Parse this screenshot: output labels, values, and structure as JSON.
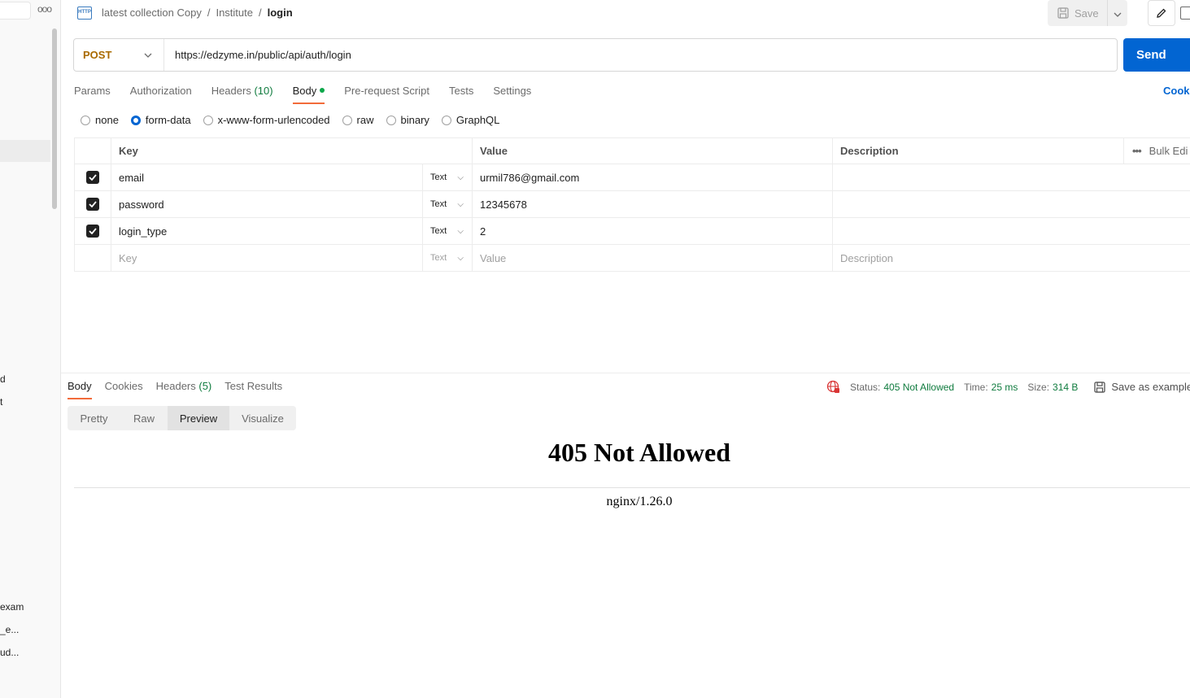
{
  "sidebar": {
    "more_label": "ooo",
    "items": [
      {
        "label": "d"
      },
      {
        "label": "t"
      },
      {
        "label": "exam"
      },
      {
        "label": "_e..."
      },
      {
        "label": "ud..."
      }
    ]
  },
  "header": {
    "http_icon_label": "HTTP",
    "breadcrumb": [
      "latest collection Copy",
      "Institute",
      "login"
    ],
    "save_label": "Save"
  },
  "request": {
    "method": "POST",
    "url": "https://edzyme.in/public/api/auth/login",
    "send_label": "Send"
  },
  "request_tabs": [
    {
      "label": "Params"
    },
    {
      "label": "Authorization"
    },
    {
      "label": "Headers",
      "count": "(10)"
    },
    {
      "label": "Body"
    },
    {
      "label": "Pre-request Script"
    },
    {
      "label": "Tests"
    },
    {
      "label": "Settings"
    }
  ],
  "cookies_label": "Cooki",
  "body_types": [
    {
      "label": "none",
      "checked": false
    },
    {
      "label": "form-data",
      "checked": true
    },
    {
      "label": "x-www-form-urlencoded",
      "checked": false
    },
    {
      "label": "raw",
      "checked": false
    },
    {
      "label": "binary",
      "checked": false
    },
    {
      "label": "GraphQL",
      "checked": false
    }
  ],
  "params_table": {
    "headers": {
      "key": "Key",
      "value": "Value",
      "description": "Description",
      "bulk_edit": "Bulk Edi"
    },
    "rows": [
      {
        "checked": true,
        "key": "email",
        "type": "Text",
        "value": "urmil786@gmail.com",
        "description": ""
      },
      {
        "checked": true,
        "key": "password",
        "type": "Text",
        "value": "12345678",
        "description": ""
      },
      {
        "checked": true,
        "key": "login_type",
        "type": "Text",
        "value": "2",
        "description": ""
      }
    ],
    "placeholder_row": {
      "key": "Key",
      "type": "Text",
      "value": "Value",
      "description": "Description"
    }
  },
  "response": {
    "tabs": [
      {
        "label": "Body"
      },
      {
        "label": "Cookies"
      },
      {
        "label": "Headers",
        "count": "(5)"
      },
      {
        "label": "Test Results"
      }
    ],
    "status_label": "Status:",
    "status_value": "405 Not Allowed",
    "time_label": "Time:",
    "time_value": "25 ms",
    "size_label": "Size:",
    "size_value": "314 B",
    "save_example_label": "Save as example",
    "view_modes": [
      "Pretty",
      "Raw",
      "Preview",
      "Visualize"
    ],
    "active_view": "Preview",
    "preview_title": "405 Not Allowed",
    "preview_footer": "nginx/1.26.0"
  },
  "colors": {
    "accent": "#0265d2",
    "tab_underline": "#f26b3a",
    "method_post": "#a96a00",
    "status_ok_text": "#0f7b3e"
  }
}
